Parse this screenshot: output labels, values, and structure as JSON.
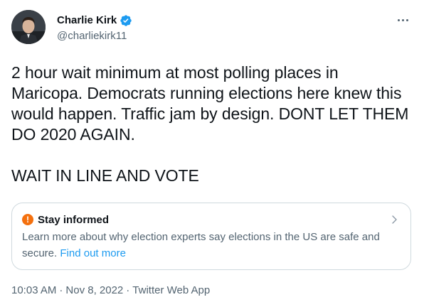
{
  "author": {
    "display_name": "Charlie Kirk",
    "handle": "@charliekirk11",
    "avatar_icon": "user-avatar",
    "verified_icon": "verified-badge-icon",
    "verified_color": "#1d9bf0"
  },
  "more_icon": "more-options-icon",
  "tweet": {
    "text_line_1": "2 hour wait minimum at most polling places in Maricopa. Democrats running elections here knew this would happen. Traffic jam by design. DONT LET THEM DO 2020 AGAIN.",
    "text_line_2": "WAIT IN LINE AND VOTE"
  },
  "notice": {
    "icon": "exclamation-icon",
    "icon_color": "#f4700e",
    "title": "Stay informed",
    "body": "Learn more about why election experts say elections in the US are safe and secure.",
    "link_text": "Find out more",
    "chevron_icon": "chevron-right-icon"
  },
  "meta": {
    "time": "10:03 AM",
    "separator_1": "·",
    "date": "Nov 8, 2022",
    "separator_2": "·",
    "source": "Twitter Web App"
  },
  "colors": {
    "text_primary": "#0f1419",
    "text_secondary": "#536471",
    "link": "#1d9bf0",
    "border": "#cfd9de"
  }
}
